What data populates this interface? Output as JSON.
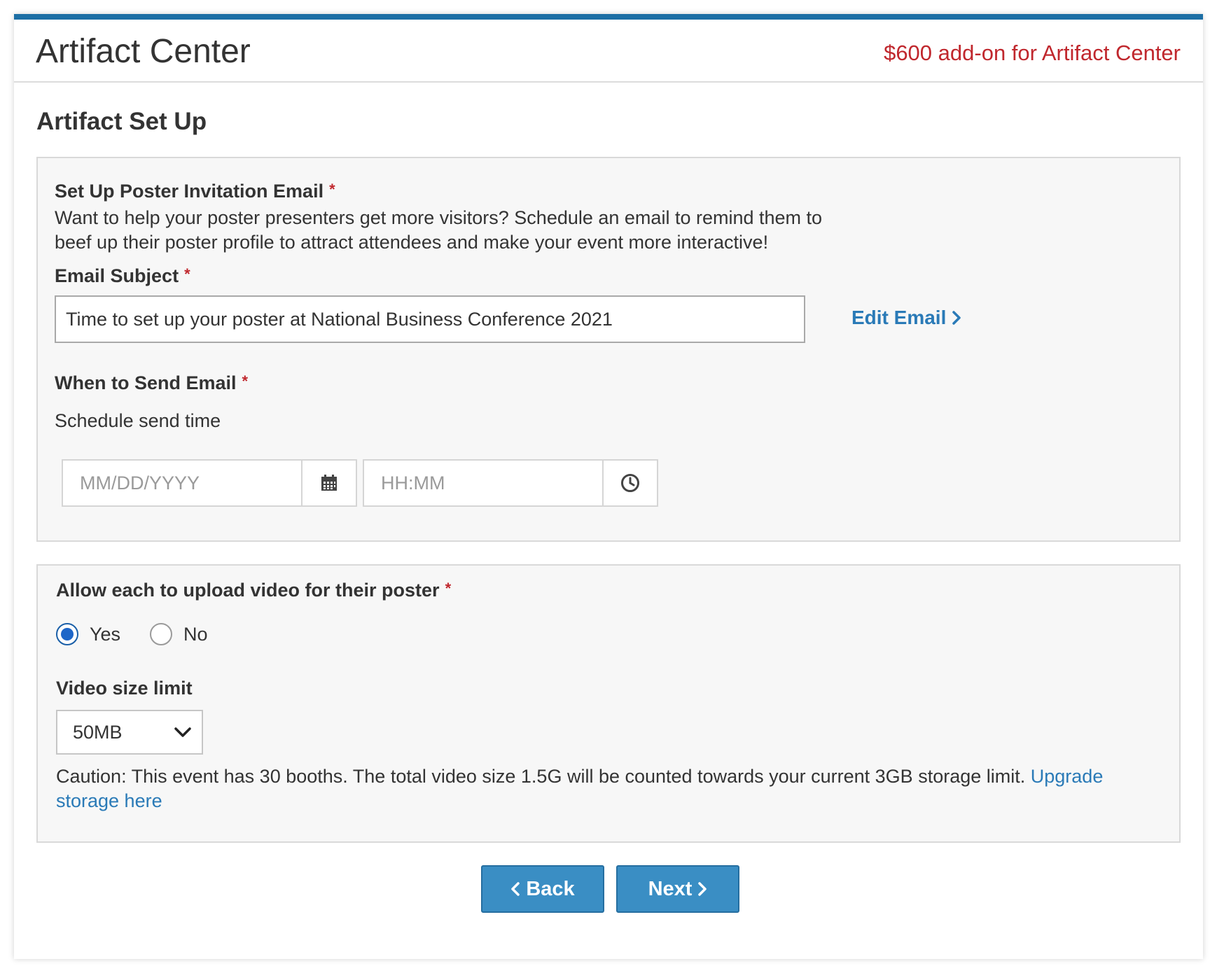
{
  "header": {
    "title": "Artifact Center",
    "addon_note": "$600 add-on for Artifact Center"
  },
  "section_title": "Artifact Set Up",
  "invitation": {
    "heading": "Set Up Poster Invitation Email",
    "description_line1": "Want to help your poster presenters get more visitors? Schedule an email to remind them to",
    "description_line2": "beef up their poster profile to attract attendees and make your event more interactive!",
    "subject_label": "Email Subject",
    "subject_value": "Time to set up your poster at National Business Conference 2021",
    "edit_email_label": "Edit Email",
    "when_label": "When to Send Email",
    "schedule_text": "Schedule send time",
    "date_placeholder": "MM/DD/YYYY",
    "time_placeholder": "HH:MM"
  },
  "video": {
    "heading": "Allow each to upload video for their poster",
    "options": [
      "Yes",
      "No"
    ],
    "selected": "Yes",
    "size_label": "Video size limit",
    "size_value": "50MB",
    "caution_text": "Caution: This event has 30 booths. The total video size 1.5G will be counted towards your current 3GB storage limit.",
    "upgrade_link_part1": "Upgrade",
    "upgrade_link_part2": "storage here"
  },
  "buttons": {
    "back": "Back",
    "next": "Next"
  },
  "required_marker": "*",
  "colors": {
    "accent_bar": "#1d6fa5",
    "addon_text": "#c0272d",
    "link": "#2a7ab7",
    "button": "#3a8ec4"
  },
  "icons": [
    "calendar-icon",
    "clock-icon",
    "chevron-right-icon",
    "chevron-left-icon",
    "chevron-down-icon"
  ]
}
